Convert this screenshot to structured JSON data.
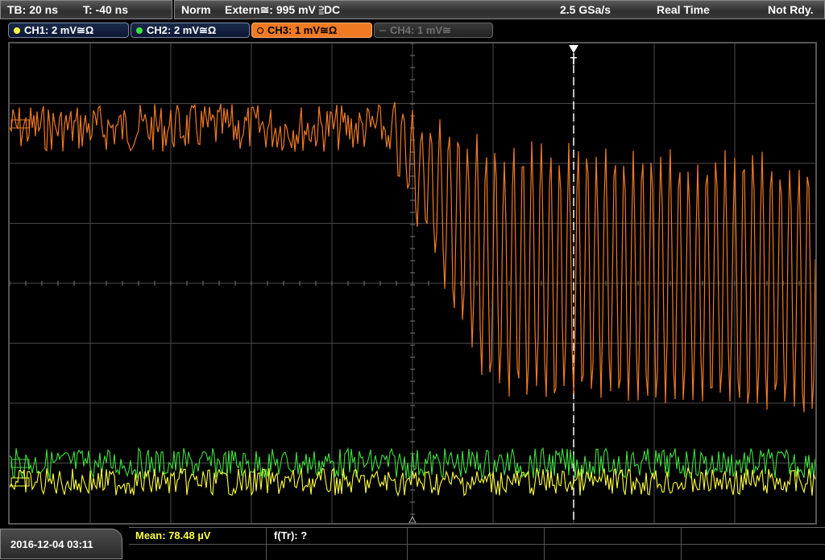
{
  "status": {
    "timebase": "TB: 20 ns",
    "trigger_time": "T: -40 ns",
    "mode": "Norm",
    "trigger_source": "Extern≅: 995 mV ⫆DC",
    "sample_rate": "2.5 GSa/s",
    "acq_mode": "Real Time",
    "state": "Not Rdy."
  },
  "channels": [
    {
      "label": "CH1: 2 mV≅Ω",
      "color": "#ffff40",
      "state": "on"
    },
    {
      "label": "CH2: 2 mV≅Ω",
      "color": "#40e040",
      "state": "on"
    },
    {
      "label": "CH3: 1 mV≅Ω",
      "color": "#f07a24",
      "state": "selected"
    },
    {
      "label": "CH4: 1 mV≅",
      "color": "#777777",
      "state": "off"
    }
  ],
  "trigger_marker": "T",
  "measurements": {
    "mean": "Mean: 78.48 µV",
    "rise_freq": "f(Tr): ?"
  },
  "datetime": "2016-12-04 03:11",
  "colors": {
    "ch1": "#ffff40",
    "ch2": "#40e040",
    "ch3": "#f07a24",
    "grid": "#4a4a4a"
  }
}
